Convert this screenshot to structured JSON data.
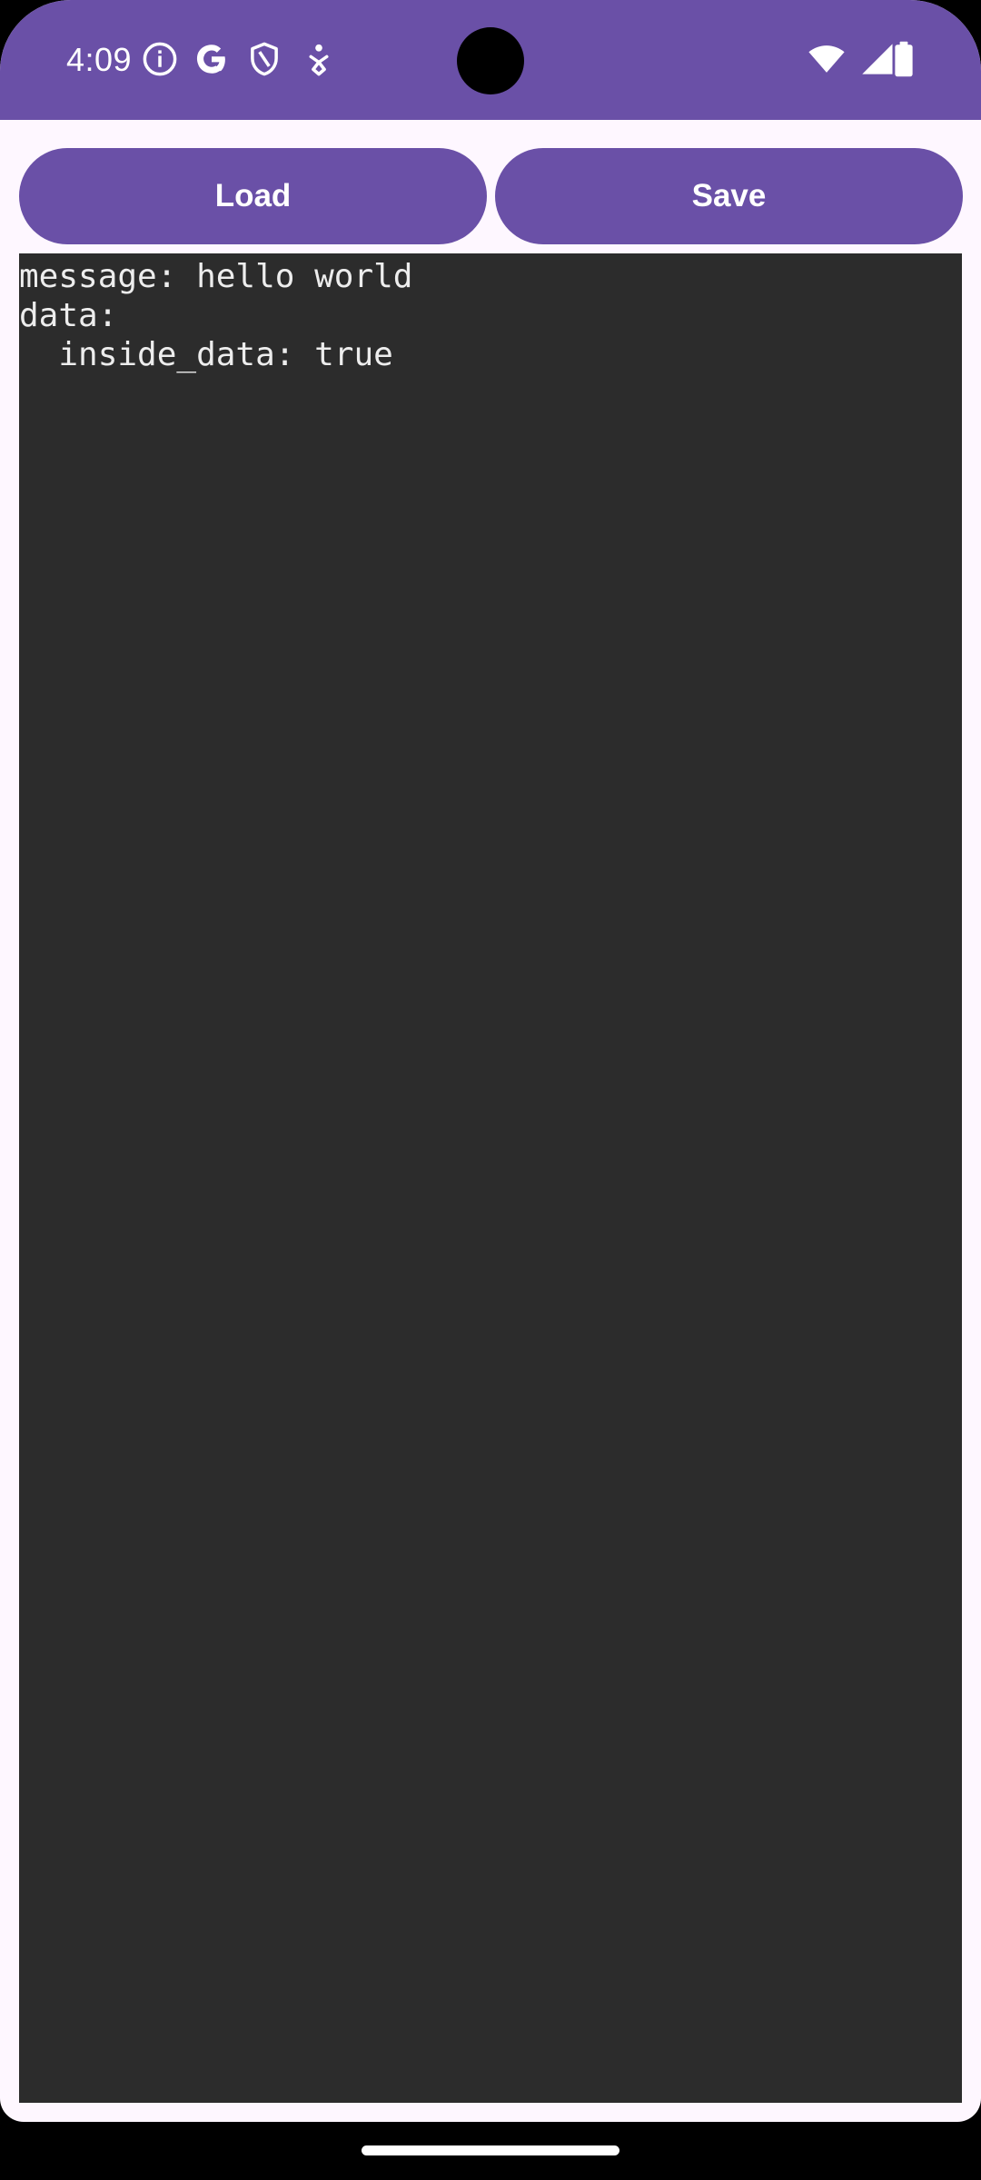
{
  "status_bar": {
    "time": "4:09",
    "background": "#6A50A7",
    "left_icons": [
      "info-icon",
      "google-icon",
      "shield-icon",
      "accessibility-icon"
    ],
    "right_icons": [
      "wifi-icon",
      "cellular-signal-icon",
      "battery-icon"
    ]
  },
  "toolbar": {
    "load_label": "Load",
    "save_label": "Save",
    "accent": "#6A50A7"
  },
  "editor": {
    "background": "#2C2C2C",
    "lines": [
      "message: hello world",
      "data:",
      "  inside_data: true"
    ]
  }
}
